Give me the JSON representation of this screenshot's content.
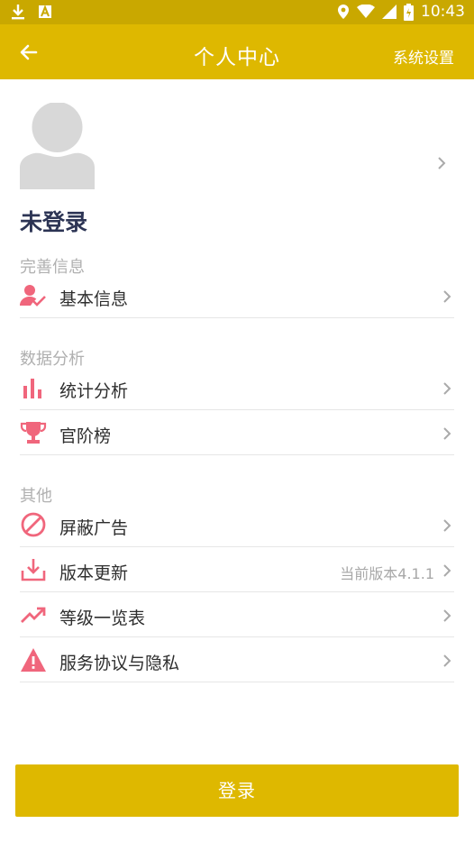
{
  "status_bar": {
    "time": "10:43",
    "icons": [
      "download-icon",
      "a-icon",
      "location-icon",
      "wifi-icon",
      "signal-icon",
      "battery-icon"
    ]
  },
  "appbar": {
    "title": "个人中心",
    "settings_label": "系统设置",
    "back_icon": "arrow-left-icon"
  },
  "profile": {
    "status": "未登录",
    "avatar_icon": "default-avatar-icon"
  },
  "sections": [
    {
      "title": "完善信息",
      "items": [
        {
          "label": "基本信息",
          "icon": "user-check-icon"
        }
      ]
    },
    {
      "title": "数据分析",
      "items": [
        {
          "label": "统计分析",
          "icon": "bar-chart-icon"
        },
        {
          "label": "官阶榜",
          "icon": "trophy-icon"
        }
      ]
    },
    {
      "title": "其他",
      "items": [
        {
          "label": "屏蔽广告",
          "icon": "block-icon"
        },
        {
          "label": "版本更新",
          "icon": "download-tray-icon",
          "extra": "当前版本4.1.1"
        },
        {
          "label": "等级一览表",
          "icon": "trending-up-icon"
        },
        {
          "label": "服务协议与隐私",
          "icon": "warning-icon"
        }
      ]
    }
  ],
  "login_button": {
    "label": "登录"
  },
  "colors": {
    "status_bar": "#c9a800",
    "app_bar": "#deb800",
    "accent_icon": "#f0667c",
    "title_text": "#2c3454"
  }
}
